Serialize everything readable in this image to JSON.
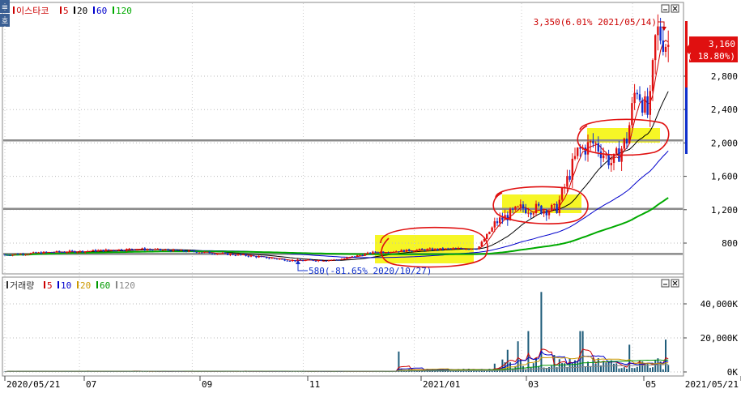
{
  "chart_data": [
    {
      "type": "candlestick",
      "title": "이스타코",
      "legend": [
        {
          "label": "이스타코",
          "color": "#cc0000"
        },
        {
          "label": "5",
          "color": "#cc0000"
        },
        {
          "label": "20",
          "color": "#000000"
        },
        {
          "label": "60",
          "color": "#0000cc"
        },
        {
          "label": "120",
          "color": "#00aa00"
        }
      ],
      "y_ticks": [
        "2,800",
        "2,400",
        "2,000",
        "1,600",
        "1,200",
        "800"
      ],
      "y_tick_values": [
        2800,
        2400,
        2000,
        1600,
        1200,
        800
      ],
      "ylim": [
        450,
        3450
      ],
      "x_ticks": [
        "2020/05/21",
        "07",
        "09",
        "11",
        "2021/01",
        "03",
        "05",
        "2021/05/21"
      ],
      "high_annotation": "3,350(6.01% 2021/05/14)",
      "low_annotation": "580(-81.65% 2020/10/27)",
      "current_price": "3,160",
      "current_change": "( 18.80%)",
      "current_value": 3160,
      "support_lines": [
        2030,
        1210,
        670
      ],
      "price_series": [
        {
          "date": "2020/05/21",
          "close": 660
        },
        {
          "date": "2020/06/15",
          "close": 690
        },
        {
          "date": "2020/07/01",
          "close": 700
        },
        {
          "date": "2020/08/01",
          "close": 730
        },
        {
          "date": "2020/09/01",
          "close": 700
        },
        {
          "date": "2020/10/01",
          "close": 650
        },
        {
          "date": "2020/10/27",
          "close": 590
        },
        {
          "date": "2020/11/20",
          "close": 600
        },
        {
          "date": "2020/12/10",
          "close": 690
        },
        {
          "date": "2021/01/05",
          "close": 720
        },
        {
          "date": "2021/02/05",
          "close": 740
        },
        {
          "date": "2021/02/15",
          "close": 1050
        },
        {
          "date": "2021/03/01",
          "close": 1220
        },
        {
          "date": "2021/03/20",
          "close": 1200
        },
        {
          "date": "2021/04/01",
          "close": 1900
        },
        {
          "date": "2021/04/10",
          "close": 2000
        },
        {
          "date": "2021/04/20",
          "close": 1750
        },
        {
          "date": "2021/04/28",
          "close": 2050
        },
        {
          "date": "2021/05/03",
          "close": 2700
        },
        {
          "date": "2021/05/10",
          "close": 2300
        },
        {
          "date": "2021/05/14",
          "close": 3350
        },
        {
          "date": "2021/05/21",
          "close": 3160
        }
      ]
    },
    {
      "type": "bar",
      "title": "거래량",
      "legend": [
        {
          "label": "거래량",
          "color": "#333333"
        },
        {
          "label": "5",
          "color": "#cc0000"
        },
        {
          "label": "10",
          "color": "#0000cc"
        },
        {
          "label": "20",
          "color": "#cc9900"
        },
        {
          "label": "60",
          "color": "#009900"
        },
        {
          "label": "120",
          "color": "#888888"
        }
      ],
      "y_ticks": [
        "40,000K",
        "20,000K",
        "0K"
      ],
      "y_tick_values": [
        40000,
        20000,
        0
      ],
      "ylim": [
        0,
        50000
      ]
    }
  ]
}
